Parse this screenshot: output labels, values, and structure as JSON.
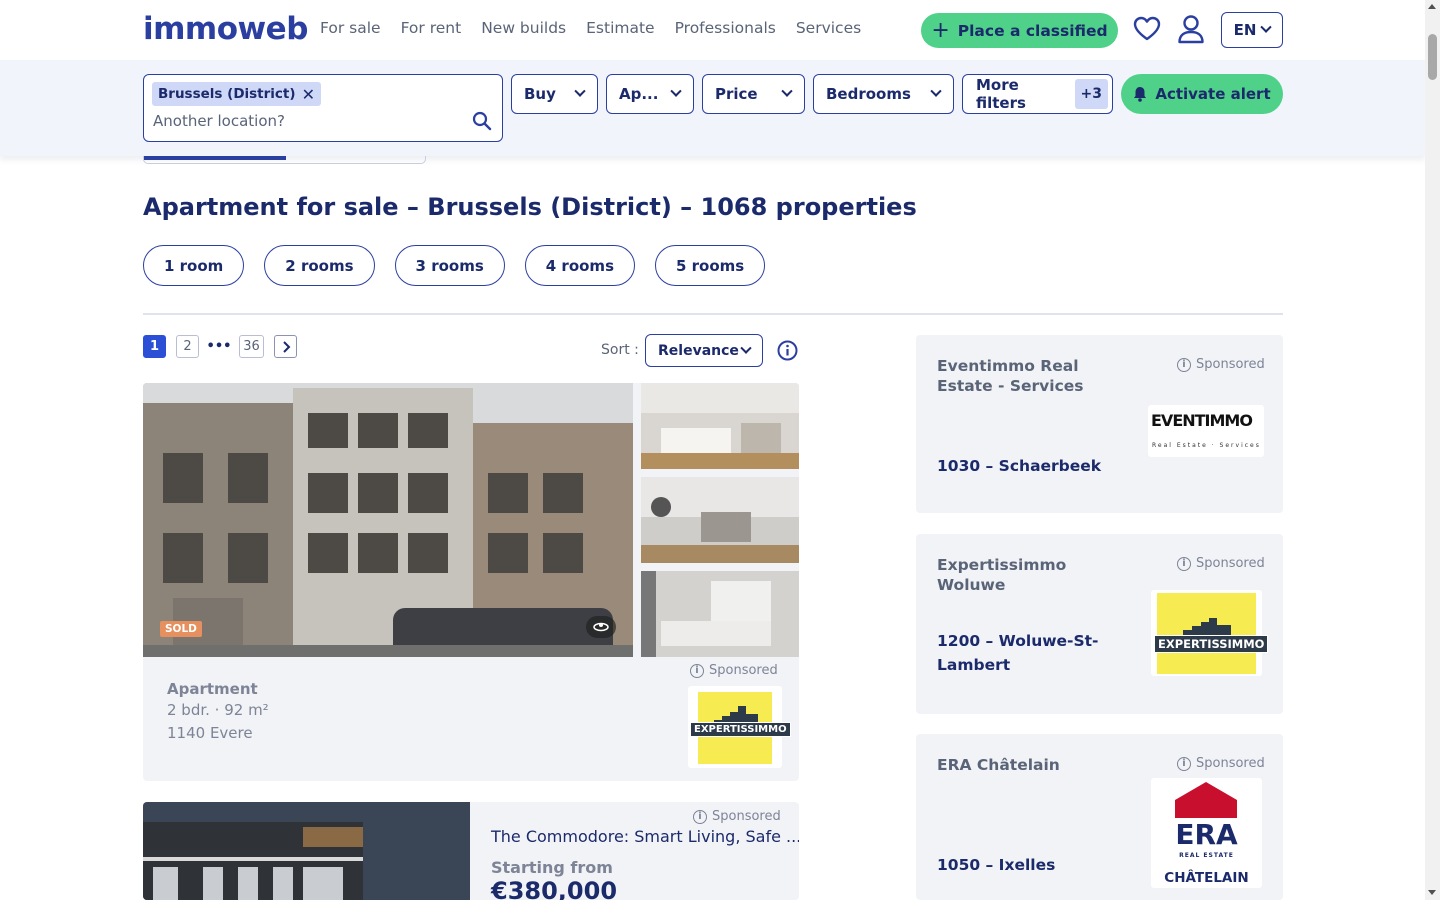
{
  "brand": {
    "logo_text": "immoweb",
    "color": "#2b3fa0",
    "accent_green": "#4fd18a"
  },
  "nav": {
    "links": [
      "For sale",
      "For rent",
      "New builds",
      "Estimate",
      "Professionals",
      "Services"
    ],
    "place_classified": "Place a classified",
    "language": "EN"
  },
  "search": {
    "location_chip": "Brussels (District)",
    "location_placeholder": "Another location?",
    "filters": {
      "transaction": "Buy",
      "property_type": "Ap...",
      "price": "Price",
      "bedrooms": "Bedrooms",
      "more_filters": "More filters",
      "more_filters_count": "+3"
    },
    "activate_alert": "Activate alert"
  },
  "results": {
    "heading": "Apartment for sale – Brussels (District) – 1068 properties",
    "room_filters": [
      "1 room",
      "2 rooms",
      "3 rooms",
      "4 rooms",
      "5 rooms"
    ],
    "pagination": {
      "current": "1",
      "next": "2",
      "ellipsis": "•••",
      "last": "36"
    },
    "sort_label": "Sort :",
    "sort_value": "Relevance"
  },
  "listings": [
    {
      "badge": "SOLD",
      "sponsored": "Sponsored",
      "type": "Apartment",
      "specs": "2 bdr. · 92 m²",
      "location": "1140 Evere",
      "agency_logo_text": "EXPERTISSIMMO"
    },
    {
      "sponsored": "Sponsored",
      "title": "The Commodore: Smart Living, Safe ...",
      "starting_from": "Starting from",
      "price": "€380,000"
    }
  ],
  "sidebar_ads": [
    {
      "name": "Eventimmo Real Estate - Services",
      "sponsored": "Sponsored",
      "location": "1030 – Schaerbeek",
      "logo_text": "EVENTIMMO",
      "logo_sub": "Real Estate · Services"
    },
    {
      "name": "Expertissimmo Woluwe",
      "sponsored": "Sponsored",
      "location": "1200 – Woluwe-St-Lambert",
      "logo_text": "EXPERTISSIMMO"
    },
    {
      "name": "ERA Châtelain",
      "sponsored": "Sponsored",
      "location": "1050 – Ixelles",
      "logo_text": "ERA",
      "logo_sub": "REAL ESTATE",
      "logo_sub2": "CHÂTELAIN"
    }
  ]
}
